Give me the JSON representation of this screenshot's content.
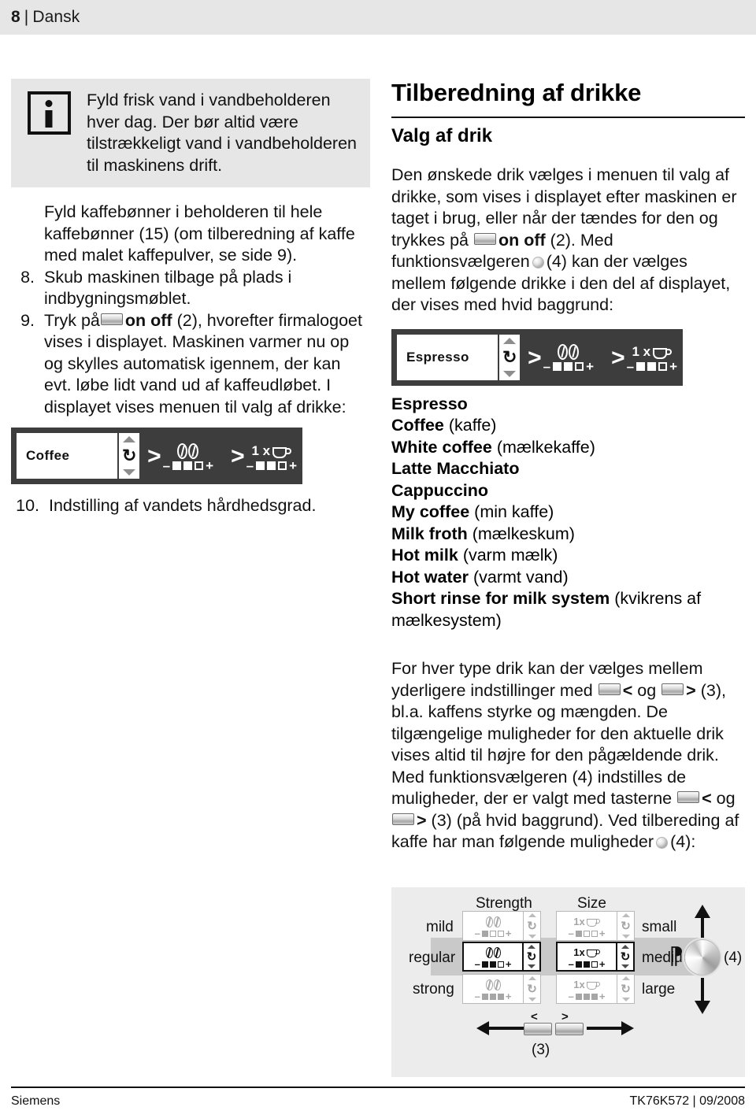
{
  "header": {
    "page_number": "8",
    "separator": "|",
    "section": "Dansk"
  },
  "left_column": {
    "info_note": "Fyld frisk vand i vandbeholderen hver dag. Der bør altid være tilstrækkeligt vand i vandbeholderen til maskinens drift.",
    "info_icon": "info-icon",
    "step_7_continuation": "Fyld kaffebønner i beholderen til hele kaffebønner (15) (om tilberedning af kaffe med malet kaffepulver, se side 9).",
    "steps": [
      {
        "num": "8.",
        "text": "Skub maskinen tilbage på plads i indbygningsmøblet."
      },
      {
        "num": "9.",
        "text_before_key": "Tryk på",
        "key_label": "on off",
        "text_after_key": "(2), hvorefter firmalogoet vises i displayet. Maskinen varmer nu op og skylles automatisk igennem, der kan evt. løbe lidt vand ud af kaffeudløbet. I displayet vises menuen til valg af drikke:"
      },
      {
        "num": "10.",
        "text": "Indstilling af vandets hårdhedsgrad."
      }
    ],
    "display": {
      "drink_name": "Coffee",
      "strength_squares": [
        "filled",
        "filled",
        "open"
      ],
      "size_label": "1 x",
      "size_squares": [
        "filled",
        "filled",
        "open"
      ],
      "minus": "–",
      "plus": "+",
      "chevron": ">"
    }
  },
  "right_column": {
    "title": "Tilberedning af drikke",
    "subtitle": "Valg af drik",
    "intro_part1": "Den ønskede drik vælges i menuen til valg af drikke, som vises i displayet efter maskinen er taget i brug, eller når der tændes for den og trykkes på",
    "intro_key": "on off",
    "intro_part2": "(2). Med funktionsvælgeren",
    "intro_part3": "(4) kan der vælges mellem følgende drikke i den del af displayet, der vises med hvid baggrund:",
    "display": {
      "drink_name": "Espresso",
      "strength_squares": [
        "filled",
        "filled",
        "open"
      ],
      "size_label": "1 x",
      "size_squares": [
        "filled",
        "filled",
        "open"
      ],
      "minus": "–",
      "plus": "+",
      "chevron": ">"
    },
    "drinks": [
      {
        "name": "Espresso",
        "translation": ""
      },
      {
        "name": "Coffee",
        "translation": "(kaffe)"
      },
      {
        "name": "White coffee",
        "translation": "(mælkekaffe)"
      },
      {
        "name": "Latte Macchiato",
        "translation": ""
      },
      {
        "name": "Cappuccino",
        "translation": ""
      },
      {
        "name": "My coffee",
        "translation": "(min kaffe)"
      },
      {
        "name": "Milk froth",
        "translation": "(mælkeskum)"
      },
      {
        "name": "Hot milk",
        "translation": "(varm mælk)"
      },
      {
        "name": "Hot water",
        "translation": "(varmt vand)"
      },
      {
        "name": "Short rinse for milk system",
        "translation": "(kvikrens af mælkesystem)"
      }
    ],
    "settings_part1": "For hver type drik kan der vælges mellem yderligere indstillinger med",
    "settings_lt": "<",
    "settings_og": "og",
    "settings_gt": ">",
    "settings_part2": "(3), bl.a. kaffens styrke og mængden. De tilgængelige muligheder for den aktuelle drik vises altid til højre for den pågældende drik. Med funktionsvælgeren (4) indstilles de muligheder, der er valgt med tasterne",
    "settings_part3": "(3) (på hvid baggrund). Ved tilbereding af kaffe har man følgende muligheder",
    "settings_part4": "(4):"
  },
  "diagram": {
    "column_headers": [
      "Strength",
      "Size"
    ],
    "strength_rows": [
      {
        "label": "mild",
        "squares": [
          "filled",
          "open",
          "open"
        ],
        "active": false
      },
      {
        "label": "regular",
        "squares": [
          "filled",
          "filled",
          "open"
        ],
        "active": true
      },
      {
        "label": "strong",
        "squares": [
          "filled",
          "filled",
          "filled"
        ],
        "active": false
      }
    ],
    "size_rows": [
      {
        "label": "small",
        "cup_label": "1x",
        "squares": [
          "filled",
          "open",
          "open"
        ],
        "active": false
      },
      {
        "label": "medium",
        "cup_label": "1x",
        "squares": [
          "filled",
          "filled",
          "open"
        ],
        "active": true
      },
      {
        "label": "large",
        "cup_label": "1x",
        "squares": [
          "filled",
          "filled",
          "filled"
        ],
        "active": false
      }
    ],
    "minus": "–",
    "plus": "+",
    "knob_callout": "(4)",
    "keys_callout": "(3)",
    "key_left_glyph": "<",
    "key_right_glyph": ">"
  },
  "footer": {
    "brand": "Siemens",
    "document_code": "TK76K572 | 09/2008"
  }
}
